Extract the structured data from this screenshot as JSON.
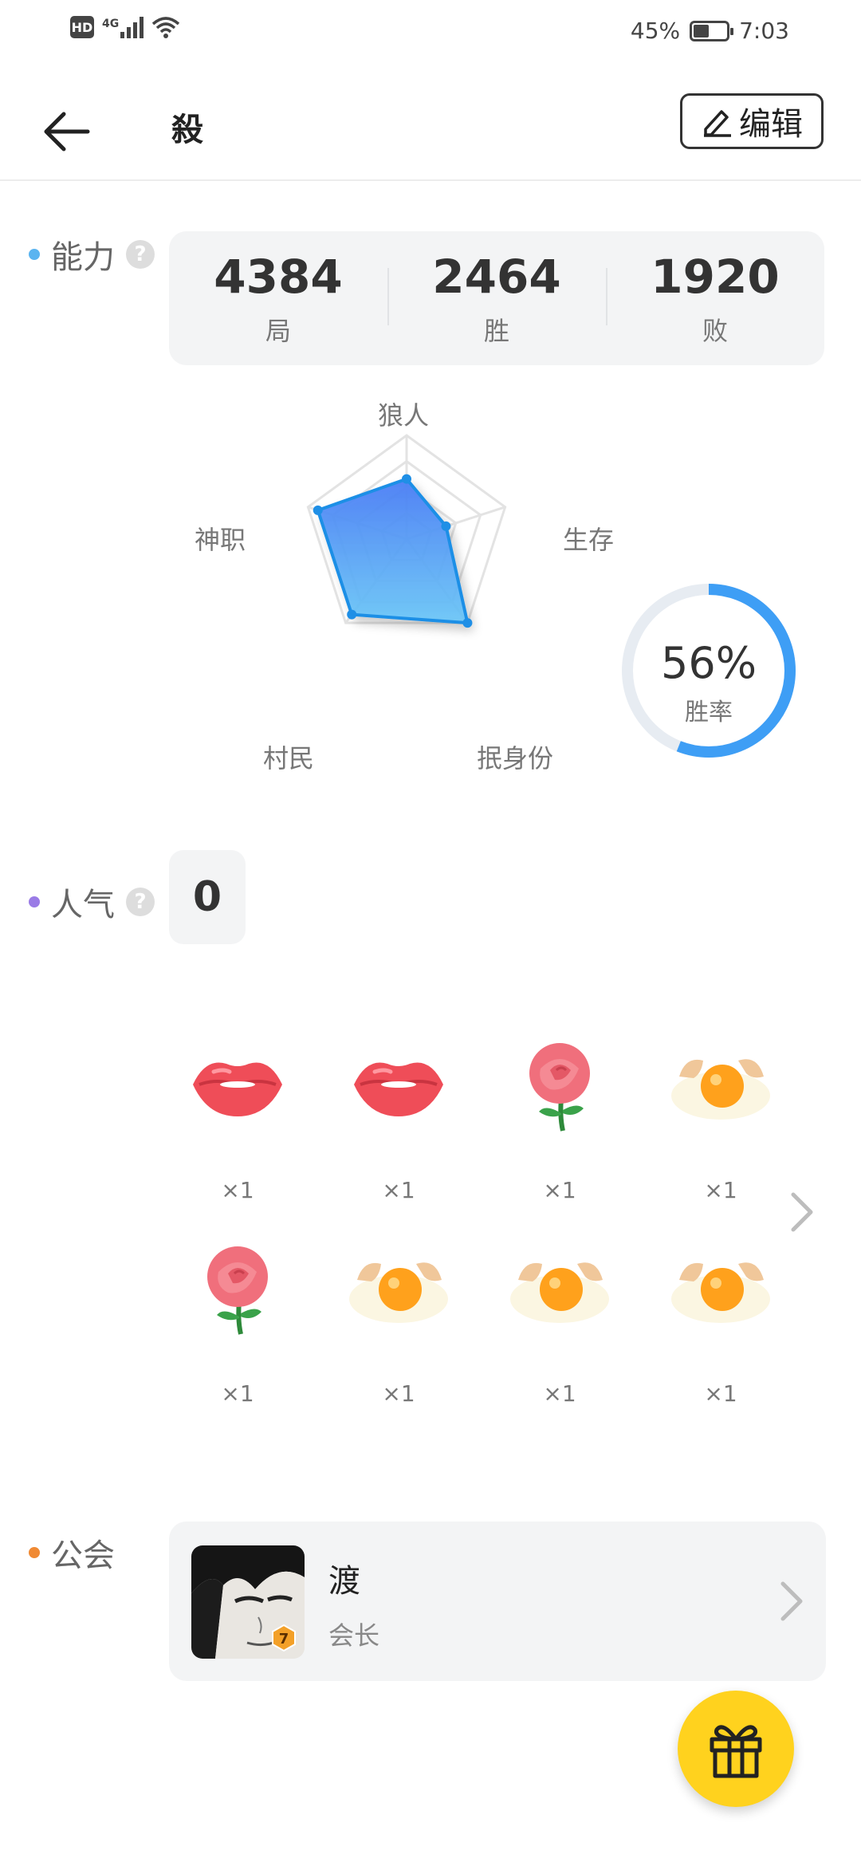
{
  "status_bar": {
    "hd": "HD",
    "network": "4G",
    "battery": "45%",
    "battery_level": 0.45,
    "time": "7:03"
  },
  "header": {
    "title": "殺",
    "edit_label": "编辑"
  },
  "ability": {
    "label": "能力",
    "help": "?",
    "stats": [
      {
        "value": "4384",
        "label": "局"
      },
      {
        "value": "2464",
        "label": "胜"
      },
      {
        "value": "1920",
        "label": "败"
      }
    ],
    "radar": {
      "axes": [
        "狼人",
        "生存",
        "抿身份",
        "村民",
        "神职"
      ],
      "values": [
        0.58,
        0.4,
        1.0,
        0.9,
        0.9
      ]
    },
    "win_rate": {
      "value": 0.56,
      "text": "56%",
      "label": "胜率"
    }
  },
  "popularity": {
    "label": "人气",
    "help": "?",
    "value": "0"
  },
  "gifts": [
    {
      "icon": "lips-icon",
      "count": "×1"
    },
    {
      "icon": "lips-icon",
      "count": "×1"
    },
    {
      "icon": "rose-icon",
      "count": "×1"
    },
    {
      "icon": "egg-icon",
      "count": "×1"
    },
    {
      "icon": "rose-icon",
      "count": "×1"
    },
    {
      "icon": "egg-icon",
      "count": "×1"
    },
    {
      "icon": "egg-icon",
      "count": "×1"
    },
    {
      "icon": "egg-icon",
      "count": "×1"
    }
  ],
  "guild": {
    "label": "公会",
    "name": "渡",
    "role": "会长",
    "level": "7"
  },
  "colors": {
    "ability_dot": "#5ab4f0",
    "popularity_dot": "#9a7be6",
    "guild_dot": "#f08a34",
    "accent_blue": "#3e9ef5",
    "fab_yellow": "#ffd21e"
  }
}
